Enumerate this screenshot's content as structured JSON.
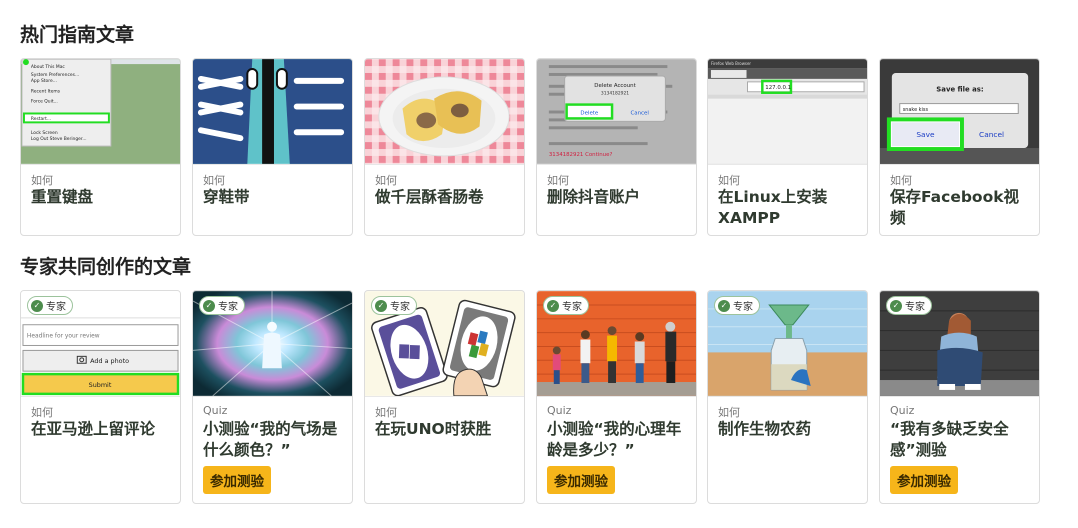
{
  "sections": [
    {
      "title": "热门指南文章",
      "cards": [
        {
          "kicker": "如何",
          "title": "重置键盘",
          "thumb": {
            "menu_items": [
              "About This Mac",
              "System Preferences...",
              "App Store...",
              "Recent Items",
              "Force Quit...",
              "Restart...",
              "Lock Screen",
              "Log Out Steve Beringer..."
            ]
          }
        },
        {
          "kicker": "如何",
          "title": "穿鞋带"
        },
        {
          "kicker": "如何",
          "title": "做千层酥香肠卷"
        },
        {
          "kicker": "如何",
          "title": "删除抖音账户",
          "thumb": {
            "dialog_title": "Delete Account",
            "dialog_number": "3134182921",
            "delete_label": "Delete",
            "cancel_label": "Cancel",
            "bottom_text": "3134182921 Continue?"
          }
        },
        {
          "kicker": "如何",
          "title": "在Linux上安装XAMPP",
          "thumb": {
            "window_title": "Firefox Web Browser",
            "url": "127.0.0.1"
          }
        },
        {
          "kicker": "如何",
          "title": "保存Facebook视频",
          "thumb": {
            "dialog_title": "Save file as:",
            "filename": "snake kiss",
            "save_label": "Save",
            "cancel_label": "Cancel"
          }
        }
      ]
    },
    {
      "title": "专家共同创作的文章",
      "cards": [
        {
          "kicker": "如何",
          "title": "在亚马逊上留评论",
          "badge": "专家",
          "thumb": {
            "placeholder": "Headline for your review",
            "photo_label": "Add a photo",
            "submit_label": "Submit"
          }
        },
        {
          "kicker": "Quiz",
          "title": "小测验“我的气场是什么颜色？”",
          "badge": "专家",
          "button": "参加测验"
        },
        {
          "kicker": "如何",
          "title": "在玩UNO时获胜",
          "badge": "专家"
        },
        {
          "kicker": "Quiz",
          "title": "小测验“我的心理年龄是多少？”",
          "badge": "专家",
          "button": "参加测验"
        },
        {
          "kicker": "如何",
          "title": "制作生物农药",
          "badge": "专家"
        },
        {
          "kicker": "Quiz",
          "title": "“我有多缺乏安全感”测验",
          "badge": "专家",
          "button": "参加测验"
        }
      ]
    }
  ]
}
